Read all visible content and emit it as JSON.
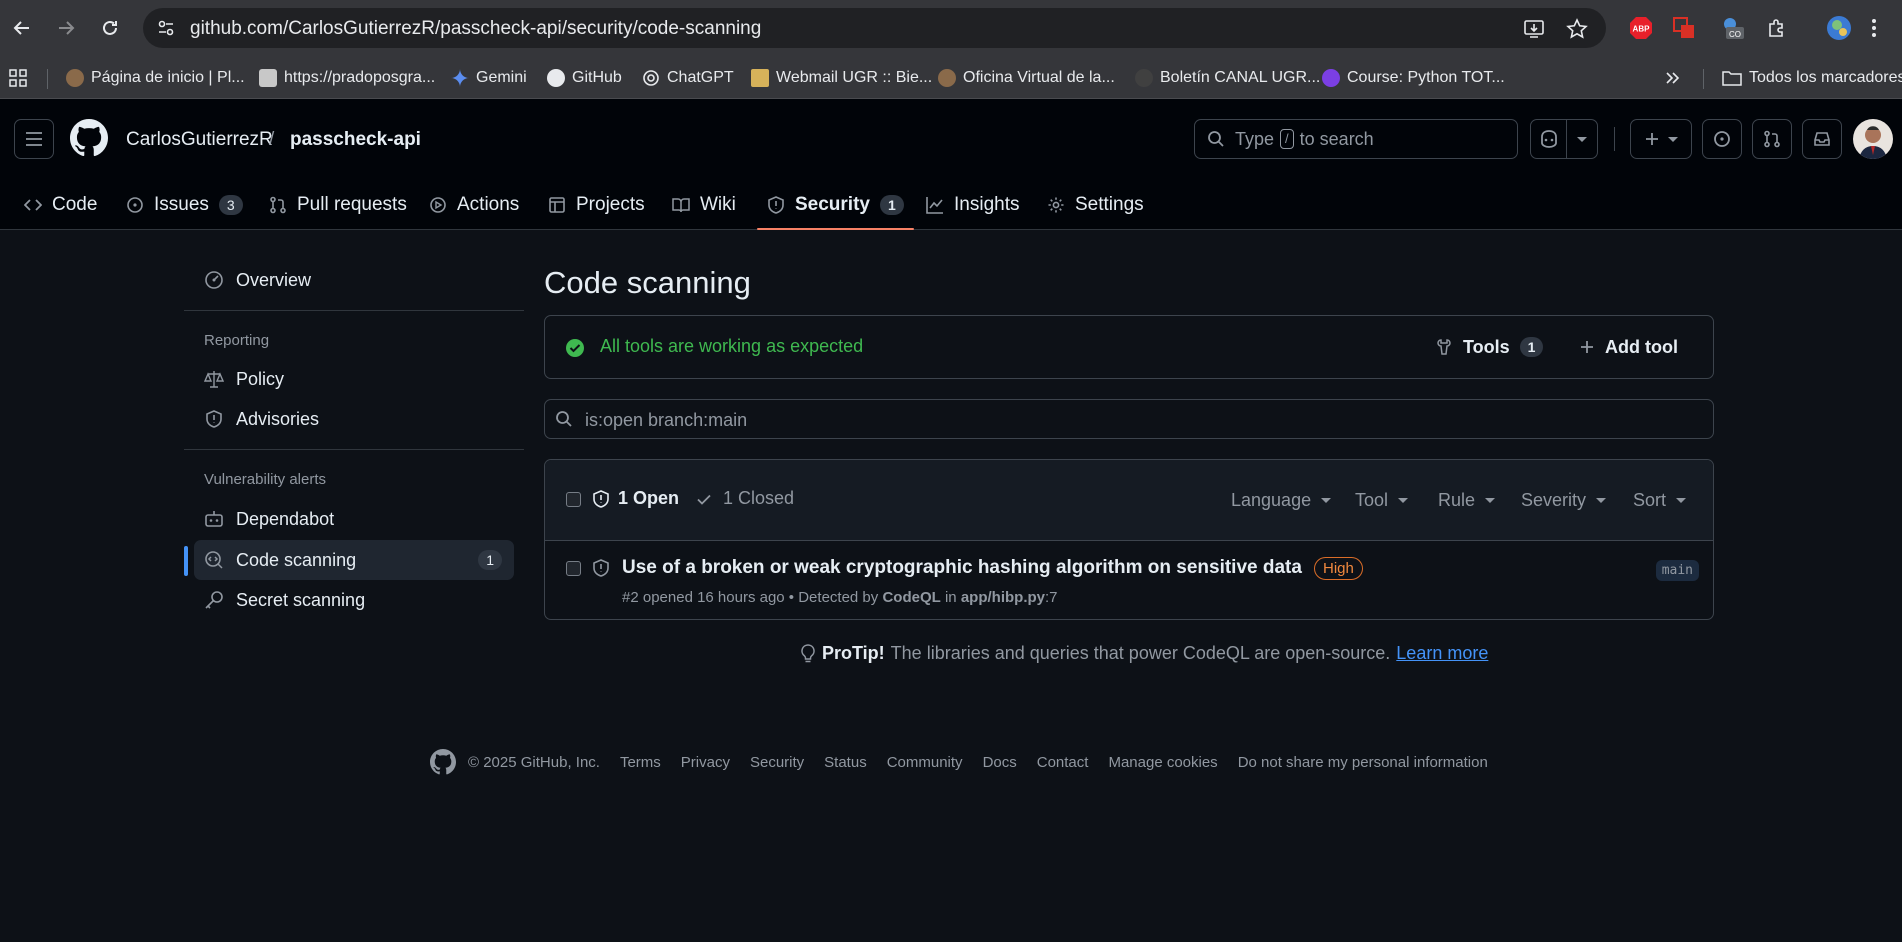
{
  "browser": {
    "url": "github.com/CarlosGutierrezR/passcheck-api/security/code-scanning",
    "bookmarks": [
      "Página de inicio | Pl...",
      "https://pradoposgra...",
      "Gemini",
      "GitHub",
      "ChatGPT",
      "Webmail UGR :: Bie...",
      "Oficina Virtual de la...",
      "Boletín CANAL UGR...",
      "Course: Python TOT..."
    ],
    "all_bookmarks": "Todos los marcadores",
    "extensions": {
      "abp": "ABP"
    }
  },
  "header": {
    "owner": "CarlosGutierrezR",
    "separator": "/",
    "repo": "passcheck-api",
    "search_pre": "Type",
    "search_key": "/",
    "search_post": "to search"
  },
  "repo_nav": {
    "tabs": [
      {
        "label": "Code"
      },
      {
        "label": "Issues",
        "count": "3"
      },
      {
        "label": "Pull requests"
      },
      {
        "label": "Actions"
      },
      {
        "label": "Projects"
      },
      {
        "label": "Wiki"
      },
      {
        "label": "Security",
        "count": "1"
      },
      {
        "label": "Insights"
      },
      {
        "label": "Settings"
      }
    ]
  },
  "sidebar": {
    "overview": "Overview",
    "reporting_heading": "Reporting",
    "policy": "Policy",
    "advisories": "Advisories",
    "vuln_heading": "Vulnerability alerts",
    "dependabot": "Dependabot",
    "code_scanning": "Code scanning",
    "code_scanning_count": "1",
    "secret_scanning": "Secret scanning"
  },
  "main": {
    "title": "Code scanning",
    "status": "All tools are working as expected",
    "tools_label": "Tools",
    "tools_count": "1",
    "add_tool": "Add tool",
    "filter_value": "is:open branch:main",
    "open_label": "1 Open",
    "closed_label": "1 Closed",
    "filters": [
      "Language",
      "Tool",
      "Rule",
      "Severity",
      "Sort"
    ],
    "alert": {
      "title": "Use of a broken or weak cryptographic hashing algorithm on sensitive data",
      "severity": "High",
      "meta_prefix": "#2 opened 16 hours ago • Detected by",
      "tool": "CodeQL",
      "meta_in": "in",
      "file": "app/hibp.py",
      "line": ":7",
      "branch": "main"
    },
    "protip_bold": "ProTip!",
    "protip_text": "The libraries and queries that power CodeQL are open-source.",
    "protip_link": "Learn more"
  },
  "footer": {
    "copyright": "© 2025 GitHub, Inc.",
    "links": [
      "Terms",
      "Privacy",
      "Security",
      "Status",
      "Community",
      "Docs",
      "Contact",
      "Manage cookies",
      "Do not share my personal information"
    ]
  }
}
